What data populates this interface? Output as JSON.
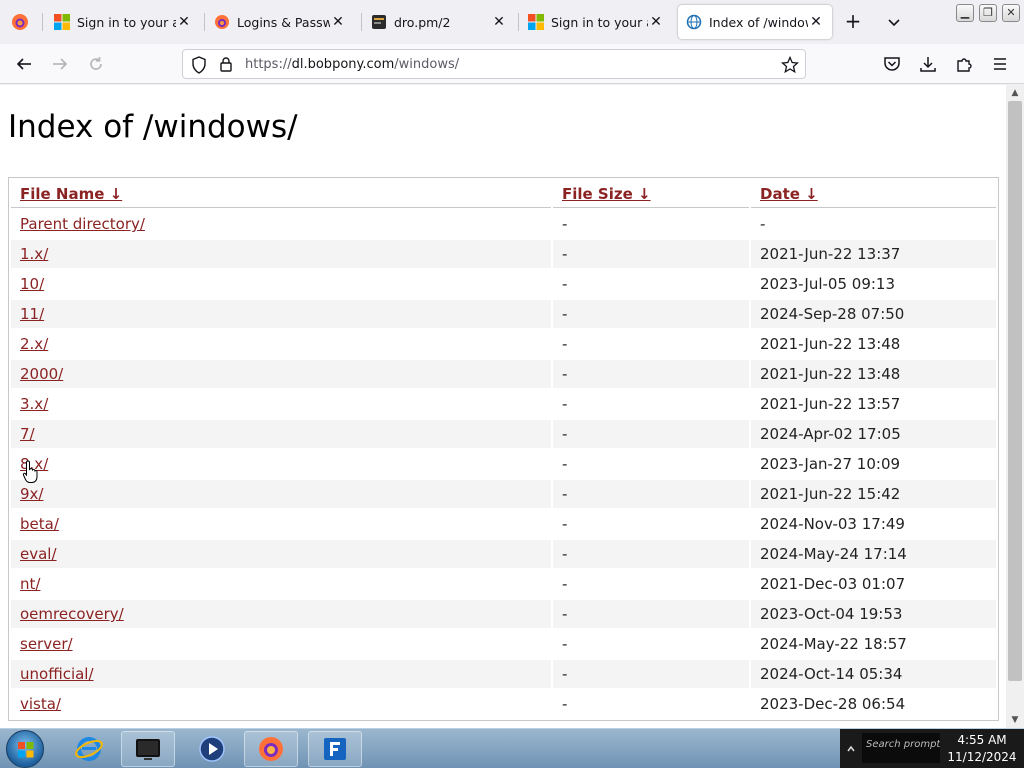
{
  "colors": {
    "link": "#8b2323",
    "tab_active_bg": "#ffffff",
    "taskbar": "#7fa2c2"
  },
  "tabs": [
    {
      "title": "Sign in to your acc",
      "icon": "microsoft-logo-icon",
      "active": false
    },
    {
      "title": "Logins & Password",
      "icon": "firefox-logo-icon",
      "active": false
    },
    {
      "title": "dro.pm/2",
      "icon": "dark-page-icon",
      "active": false
    },
    {
      "title": "Sign in to your acc",
      "icon": "microsoft-logo-icon",
      "active": false
    },
    {
      "title": "Index of /windows/",
      "icon": "globe-page-icon",
      "active": true
    }
  ],
  "address_bar": {
    "scheme": "https://",
    "host": "dl.bobpony.com",
    "path": "/windows/"
  },
  "page": {
    "title": "Index of /windows/",
    "columns": {
      "name": "File Name  ↓",
      "size": "File Size  ↓",
      "date": "Date  ↓"
    },
    "rows": [
      {
        "name": "Parent directory/",
        "size": "-",
        "date": "-"
      },
      {
        "name": "1.x/",
        "size": "-",
        "date": "2021-Jun-22 13:37"
      },
      {
        "name": "10/",
        "size": "-",
        "date": "2023-Jul-05 09:13"
      },
      {
        "name": "11/",
        "size": "-",
        "date": "2024-Sep-28 07:50"
      },
      {
        "name": "2.x/",
        "size": "-",
        "date": "2021-Jun-22 13:48"
      },
      {
        "name": "2000/",
        "size": "-",
        "date": "2021-Jun-22 13:48"
      },
      {
        "name": "3.x/",
        "size": "-",
        "date": "2021-Jun-22 13:57"
      },
      {
        "name": "7/",
        "size": "-",
        "date": "2024-Apr-02 17:05"
      },
      {
        "name": "8.x/",
        "size": "-",
        "date": "2023-Jan-27 10:09"
      },
      {
        "name": "9x/",
        "size": "-",
        "date": "2021-Jun-22 15:42"
      },
      {
        "name": "beta/",
        "size": "-",
        "date": "2024-Nov-03 17:49"
      },
      {
        "name": "eval/",
        "size": "-",
        "date": "2024-May-24 17:14"
      },
      {
        "name": "nt/",
        "size": "-",
        "date": "2021-Dec-03 01:07"
      },
      {
        "name": "oemrecovery/",
        "size": "-",
        "date": "2023-Oct-04 19:53"
      },
      {
        "name": "server/",
        "size": "-",
        "date": "2024-May-22 18:57"
      },
      {
        "name": "unofficial/",
        "size": "-",
        "date": "2024-Oct-14 05:34"
      },
      {
        "name": "vista/",
        "size": "-",
        "date": "2023-Dec-28 06:54"
      }
    ]
  },
  "taskbar": {
    "search_text": "Search prompt",
    "time": "4:55 AM",
    "date": "11/12/2024"
  }
}
